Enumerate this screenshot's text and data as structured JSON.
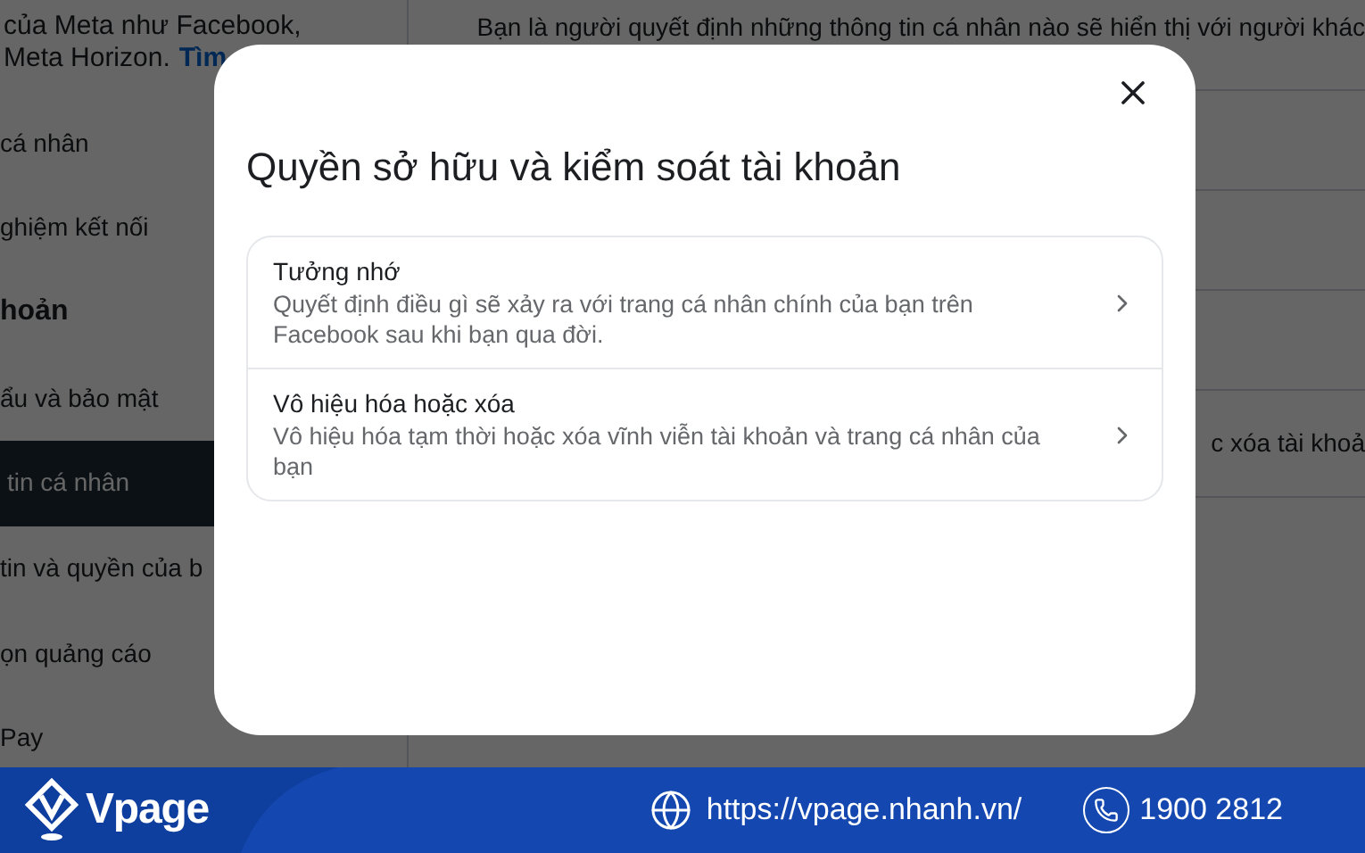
{
  "background": {
    "sidebar": {
      "intro_lines": [
        "của Meta như Facebook,",
        "Meta Horizon."
      ],
      "link": "Tìm",
      "items": [
        {
          "label": "cá nhân",
          "kind": "item",
          "selected": false
        },
        {
          "label": "ghiệm kết nối",
          "kind": "item",
          "selected": false
        },
        {
          "label": "hoản",
          "kind": "header",
          "selected": false
        },
        {
          "label": "ẩu và bảo mật",
          "kind": "item",
          "selected": false
        },
        {
          "label": "tin cá nhân",
          "kind": "item",
          "selected": true
        },
        {
          "label": "tin và quyền của b",
          "kind": "item",
          "selected": false
        },
        {
          "label": "ọn quảng cáo",
          "kind": "item",
          "selected": false
        },
        {
          "label": "Pay",
          "kind": "item",
          "selected": false
        }
      ]
    },
    "content": {
      "text": "Bạn là người quyết định những thông tin cá nhân nào sẽ hiển thị với người khác",
      "row_label": "c xóa tài khoả"
    }
  },
  "dialog": {
    "title": "Quyền sở hữu và kiểm soát tài khoản",
    "options": [
      {
        "title": "Tưởng nhớ",
        "description": "Quyết định điều gì sẽ xảy ra với trang cá nhân chính của bạn trên Facebook sau khi bạn qua đời."
      },
      {
        "title": "Vô hiệu hóa hoặc xóa",
        "description": "Vô hiệu hóa tạm thời hoặc xóa vĩnh viễn tài khoản và trang cá nhân của bạn"
      }
    ]
  },
  "footer": {
    "brand": "Vpage",
    "url": "https://vpage.nhanh.vn/",
    "phone": "1900 2812"
  }
}
